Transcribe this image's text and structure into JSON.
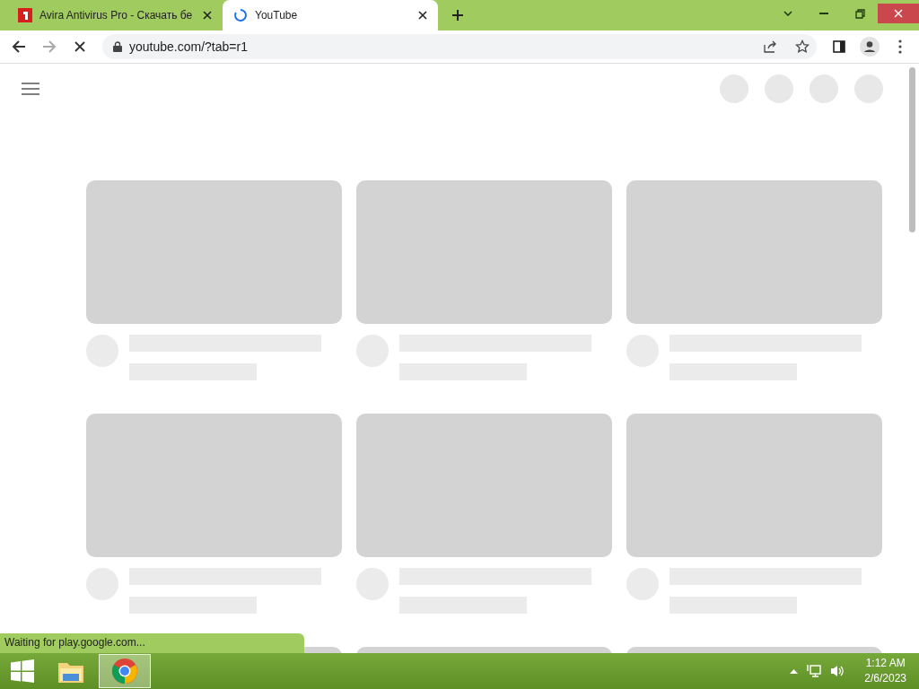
{
  "tabs": [
    {
      "title": "Avira Antivirus Pro - Скачать бе",
      "kind": "logo",
      "selected": false
    },
    {
      "title": "YouTube",
      "kind": "loading",
      "selected": true
    }
  ],
  "address_bar": {
    "url": "youtube.com/?tab=r1"
  },
  "status_bubble": "Waiting for play.google.com...",
  "taskbar": {
    "apps": [
      {
        "kind": "folder",
        "selected": false
      },
      {
        "kind": "browser",
        "selected": true
      }
    ],
    "time": "1:12 AM",
    "date": "2/6/2023"
  }
}
